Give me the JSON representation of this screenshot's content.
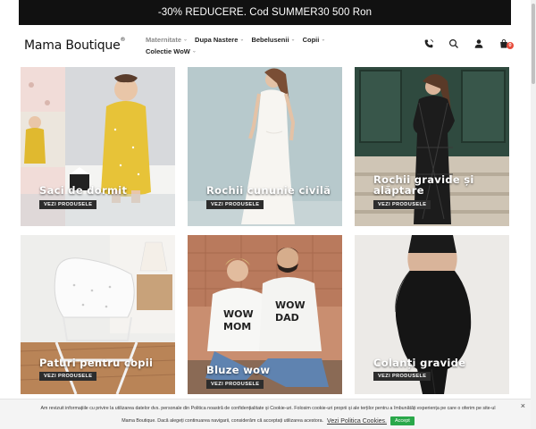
{
  "promo": {
    "text": "-30% REDUCERE. Cod SUMMER30 500 Ron"
  },
  "header": {
    "logo": "Mama Boutique",
    "logo_mark": "®",
    "cart_count": "0"
  },
  "nav": {
    "items": [
      {
        "label": "Maternitate",
        "chevron": "⌄"
      },
      {
        "label": "Dupa Nastere",
        "chevron": "⌄"
      },
      {
        "label": "Bebelusenii",
        "chevron": "⌄"
      },
      {
        "label": "Copii",
        "chevron": "⌄"
      },
      {
        "label": "Colectie WoW",
        "chevron": "⌄"
      }
    ]
  },
  "icons": [
    "phone-icon",
    "search-icon",
    "user-icon",
    "cart-icon"
  ],
  "tiles": [
    {
      "title": "Saci de dormit",
      "button": "VEZI PRODUSELE"
    },
    {
      "title": "Rochii cununie civilă",
      "button": "VEZI PRODUSELE"
    },
    {
      "title": "Rochii gravide și alăptare",
      "button": "VEZI PRODUSELE"
    },
    {
      "title": "Paturi pentru copii",
      "button": "VEZI PRODUSELE"
    },
    {
      "title": "Bluze wow",
      "button": "VEZI PRODUSELE"
    },
    {
      "title": "Colanți gravide",
      "button": "VEZI PRODUSELE"
    }
  ],
  "cookie": {
    "line1": "Am revizuit informațiile cu privire la utilizarea datelor dvs. personale din Politica noastră de confidențialitate și Cookie-uri. Folosim cookie-uri proprii și ale terților pentru a îmbunătăți experiența pe care o oferim pe site-ul",
    "line2": "Mama Boutique. Dacă alegeți continuarea navigarii, considerăm că acceptați utilizarea acestora.",
    "link": "Vezi Politica Cookies.",
    "accept": "Accept",
    "close": "×"
  },
  "colors": {
    "promo_bg": "#111111",
    "accept_green": "#2aa84a",
    "cart_badge": "#e74c3c"
  }
}
